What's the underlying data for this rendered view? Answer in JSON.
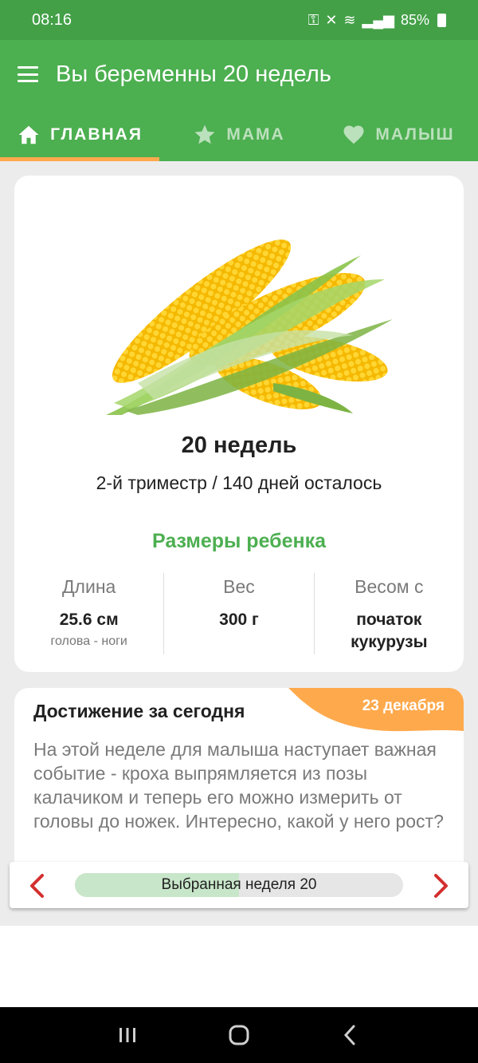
{
  "status_bar": {
    "time": "08:16",
    "battery": "85%"
  },
  "app_bar": {
    "title": "Вы беременны 20 недель"
  },
  "tabs": [
    {
      "label": "ГЛАВНАЯ",
      "icon": "home-icon",
      "active": true
    },
    {
      "label": "МАМА",
      "icon": "star-icon",
      "active": false
    },
    {
      "label": "МАЛЫШ",
      "icon": "heart-icon",
      "active": false
    }
  ],
  "main_card": {
    "image": "corn-image",
    "week_title": "20 недель",
    "trimester_info": "2-й триместр / 140 дней осталось",
    "sizes_title": "Размеры ребенка",
    "stats": [
      {
        "label": "Длина",
        "value": "25.6 см",
        "sub": "голова - ноги"
      },
      {
        "label": "Вес",
        "value": "300 г",
        "sub": ""
      },
      {
        "label": "Весом с",
        "value": "початок кукурузы",
        "sub": ""
      }
    ]
  },
  "achievement": {
    "title": "Достижение за сегодня",
    "date": "23 декабря",
    "text": "На этой неделе для малыша наступает важная событие - кроха выпрямляется из позы калачиком и теперь его можно измерить от головы до ножек. Интересно, какой у него рост?"
  },
  "week_nav": {
    "label": "Выбранная неделя 20",
    "progress_fraction": 0.5
  },
  "colors": {
    "status_bar": "#43a047",
    "primary": "#4caf50",
    "accent": "#ffa94d",
    "arrow": "#d32f2f"
  }
}
